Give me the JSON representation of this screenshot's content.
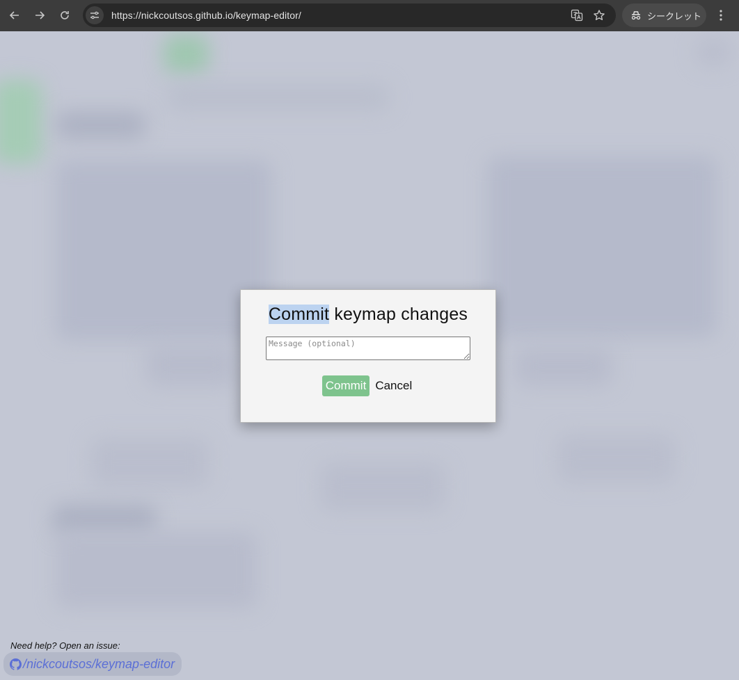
{
  "browser": {
    "url": "https://nickcoutsos.github.io/keymap-editor/",
    "incognito_label": "シークレット"
  },
  "modal": {
    "title_selected": "Commit",
    "title_rest": " keymap changes",
    "message_placeholder": "Message (optional)",
    "commit_label": "Commit",
    "cancel_label": "Cancel"
  },
  "footer": {
    "help_text": "Need help? Open an issue:",
    "repo_link": "/nickcoutsos/keymap-editor"
  },
  "colors": {
    "accent": "#7ec38d",
    "link": "#5b6fd6",
    "overlay": "#c3c7d4"
  }
}
